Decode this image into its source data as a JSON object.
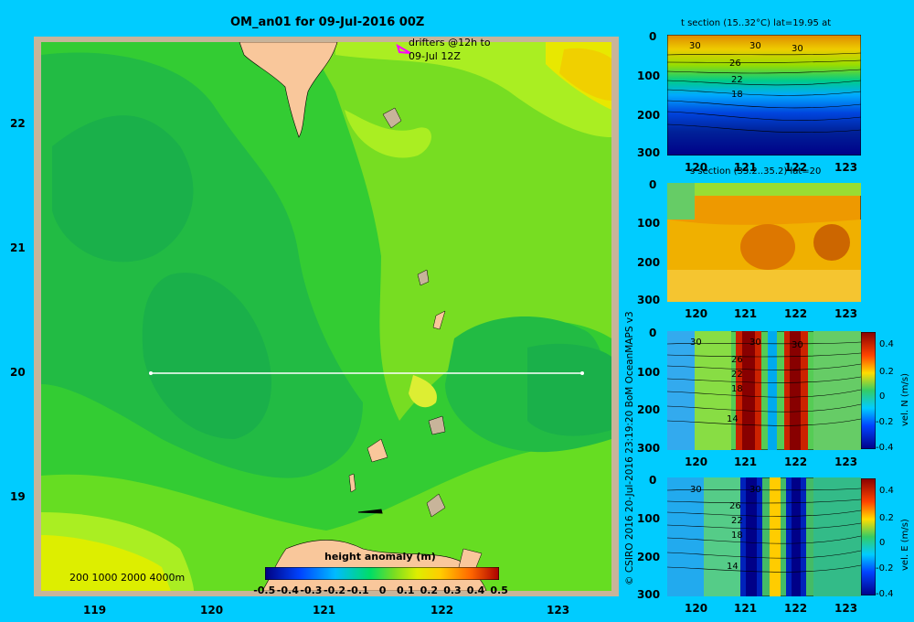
{
  "main_map": {
    "title": "OM_an01 for 09-Jul-2016 00Z",
    "drifter_label_line1": "drifters @12h to",
    "drifter_label_line2": "09-Jul 12Z",
    "depth_legend": "200  1000  2000  4000m",
    "lat_ticks": [
      "22",
      "21",
      "20",
      "19"
    ],
    "lon_ticks": [
      "119",
      "120",
      "121",
      "122",
      "123"
    ],
    "colorbar": {
      "title": "height anomaly (m)",
      "ticks": [
        "-0.5",
        "-0.4",
        "-0.3",
        "-0.2",
        "-0.1",
        "0",
        "0.1",
        "0.2",
        "0.3",
        "0.4",
        "0.5"
      ]
    }
  },
  "credit": "© CSIRO 2016   20-Jul-2016 23:19:20 BoM OceanMAPS v3",
  "panels": [
    {
      "id": "t-section",
      "title": "t section (15..32°C) lat=19.95 at",
      "depth_ticks": [
        "0",
        "100",
        "200",
        "300"
      ],
      "lon_ticks": [
        "120",
        "121",
        "122",
        "123"
      ],
      "contour_labels": [
        "30",
        "30",
        "30",
        "26",
        "22",
        "18"
      ]
    },
    {
      "id": "s-section",
      "title": "s section (33.2..35.2) lat=20",
      "depth_ticks": [
        "0",
        "100",
        "200",
        "300"
      ],
      "lon_ticks": [
        "120",
        "121",
        "122",
        "123"
      ]
    },
    {
      "id": "vel-n",
      "title": "",
      "depth_ticks": [
        "0",
        "100",
        "200",
        "300"
      ],
      "lon_ticks": [
        "120",
        "121",
        "122",
        "123"
      ],
      "contour_labels": [
        "30",
        "30",
        "30",
        "26",
        "22",
        "18",
        "14"
      ],
      "cbar_label": "vel. N (m/s)",
      "cbar_ticks": [
        "0.4",
        "0.2",
        "0",
        "-0.2",
        "-0.4"
      ]
    },
    {
      "id": "vel-e",
      "title": "",
      "depth_ticks": [
        "0",
        "100",
        "200",
        "300"
      ],
      "lon_ticks": [
        "120",
        "121",
        "122",
        "123"
      ],
      "contour_labels": [
        "30",
        "30",
        "26",
        "22",
        "18",
        "14"
      ],
      "cbar_label": "vel. E (m/s)",
      "cbar_ticks": [
        "0.4",
        "0.2",
        "0",
        "-0.2",
        "-0.4"
      ]
    }
  ],
  "colors": {
    "background": "#00ccff",
    "land": "#f9c79b",
    "frame": "#c8b49a",
    "section_line": "#ffffff",
    "drifter": "#ff00ff"
  }
}
